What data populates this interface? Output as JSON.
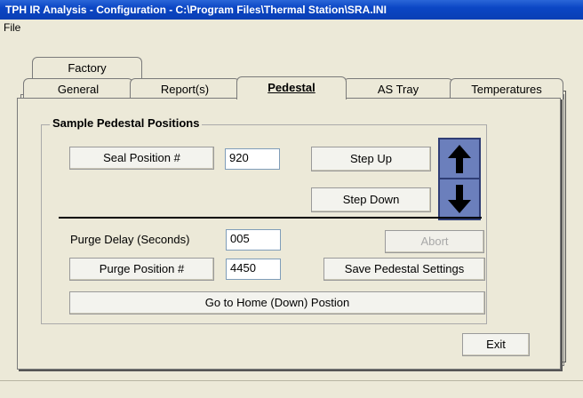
{
  "window": {
    "title": "TPH IR Analysis - Configuration - C:\\Program Files\\Thermal Station\\SRA.INI"
  },
  "menu": {
    "file": "File"
  },
  "tabs": {
    "row_back": [
      "Factory"
    ],
    "row_front": [
      "General",
      "Report(s)",
      "Pedestal",
      "AS Tray",
      "Temperatures"
    ],
    "active": "Pedestal"
  },
  "group": {
    "title": "Sample Pedestal Positions"
  },
  "seal": {
    "button": "Seal Position #",
    "value": "920"
  },
  "step_up": {
    "label": "Step Up",
    "icon": "arrow-up-icon"
  },
  "step_down": {
    "label": "Step Down",
    "icon": "arrow-down-icon"
  },
  "purge_delay": {
    "label": "Purge Delay (Seconds)",
    "value": "005"
  },
  "abort": {
    "label": "Abort"
  },
  "purge_position": {
    "button": "Purge Position #",
    "value": "4450"
  },
  "save": {
    "label": "Save Pedestal Settings"
  },
  "home": {
    "label": "Go to Home (Down) Postion"
  },
  "exit": {
    "label": "Exit"
  }
}
